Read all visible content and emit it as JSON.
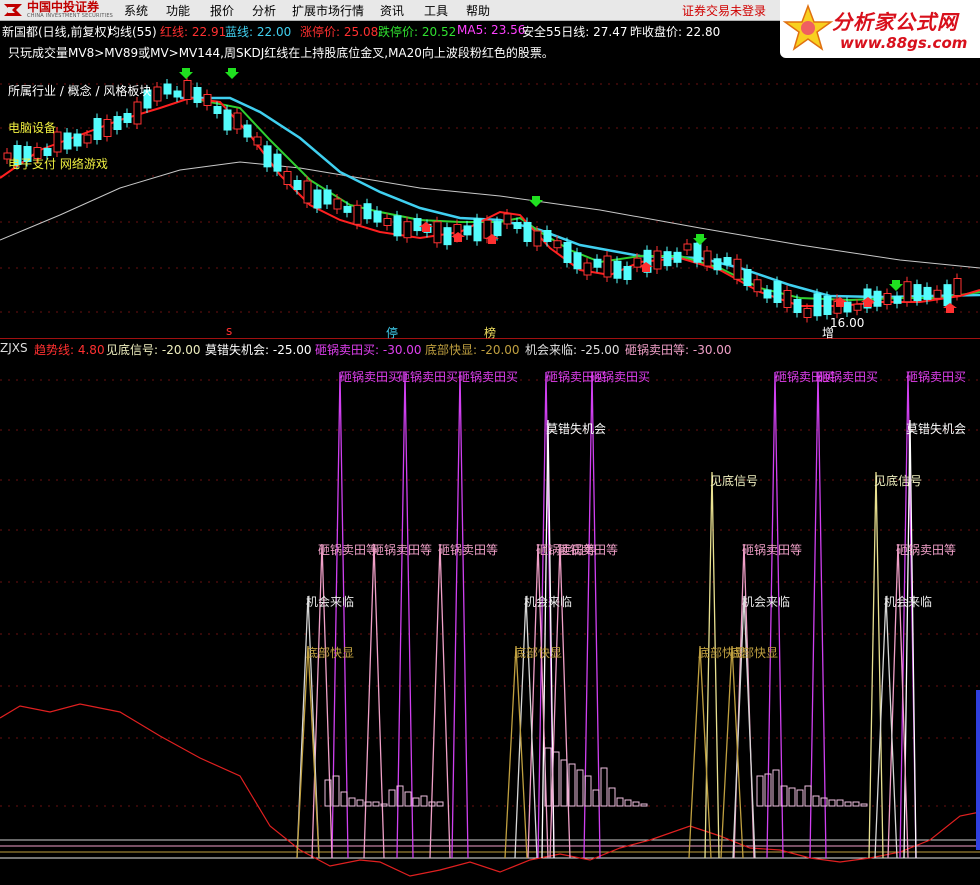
{
  "menu": {
    "logo_cn": "中国中投证券",
    "logo_en": "CHINA INVESTMENT SECURITIES",
    "items": [
      "系统",
      "功能",
      "报价",
      "分析",
      "扩展市场行情",
      "资讯",
      "工具",
      "帮助"
    ],
    "login_status": "证券交易未登录"
  },
  "banner": {
    "title": "分析家公式网",
    "url": "www.88gs.com"
  },
  "main_header": {
    "stock": "新国都(日线,前复权)",
    "ma_label": "均线(55)",
    "red_line": "红线: 22.91",
    "blue_line": "蓝线: 22.00",
    "limit_up": "涨停价: 25.08",
    "limit_down": "跌停价: 20.52",
    "ma5": "MA5: 23.56",
    "safe55": "安全55日线: 27.47",
    "prev_close": "昨收盘价: 22.80"
  },
  "description": "只玩成交量MV8>MV89或MV>MV144,周SKDJ红线在上持股底位金叉,MA20向上波段粉红色的股票。",
  "sector": {
    "industry_label": "所属行业 / 概念 / 风格板块",
    "industry": "电脑设备",
    "concepts": "电子支付 网络游戏"
  },
  "low_price_label": "16.00",
  "markers": [
    "s",
    "停",
    "榜",
    "增"
  ],
  "sub_header": {
    "name": "ZJXS",
    "trend": "趋势线: 4.80",
    "bottom_signal": "见底信号: -20.00",
    "miss_chance": "莫错失机会: -25.00",
    "pot_sell_buy": "砸锅卖田买: -30.00",
    "bottom_fast": "底部快显: -20.00",
    "chance_comes": "机会来临: -25.00",
    "pot_sell_wait": "砸锅卖田等: -30.00"
  },
  "signal_labels": {
    "buy": "砸锅卖田买",
    "miss": "莫错失机会",
    "bottom": "见底信号",
    "wait": "砸锅卖田等",
    "chance": "机会来临",
    "fast": "底部快显"
  },
  "colors": {
    "up": "#ff3232",
    "down": "#54fcfc",
    "ma_red": "#ff2020",
    "ma_blue": "#40d0f0",
    "ma_green": "#30d030",
    "ma_white": "#c8c8c8",
    "magenta": "#d040f0",
    "pink": "#f0a0c8",
    "yellow": "#e8e090",
    "trend": "#e02020"
  }
}
